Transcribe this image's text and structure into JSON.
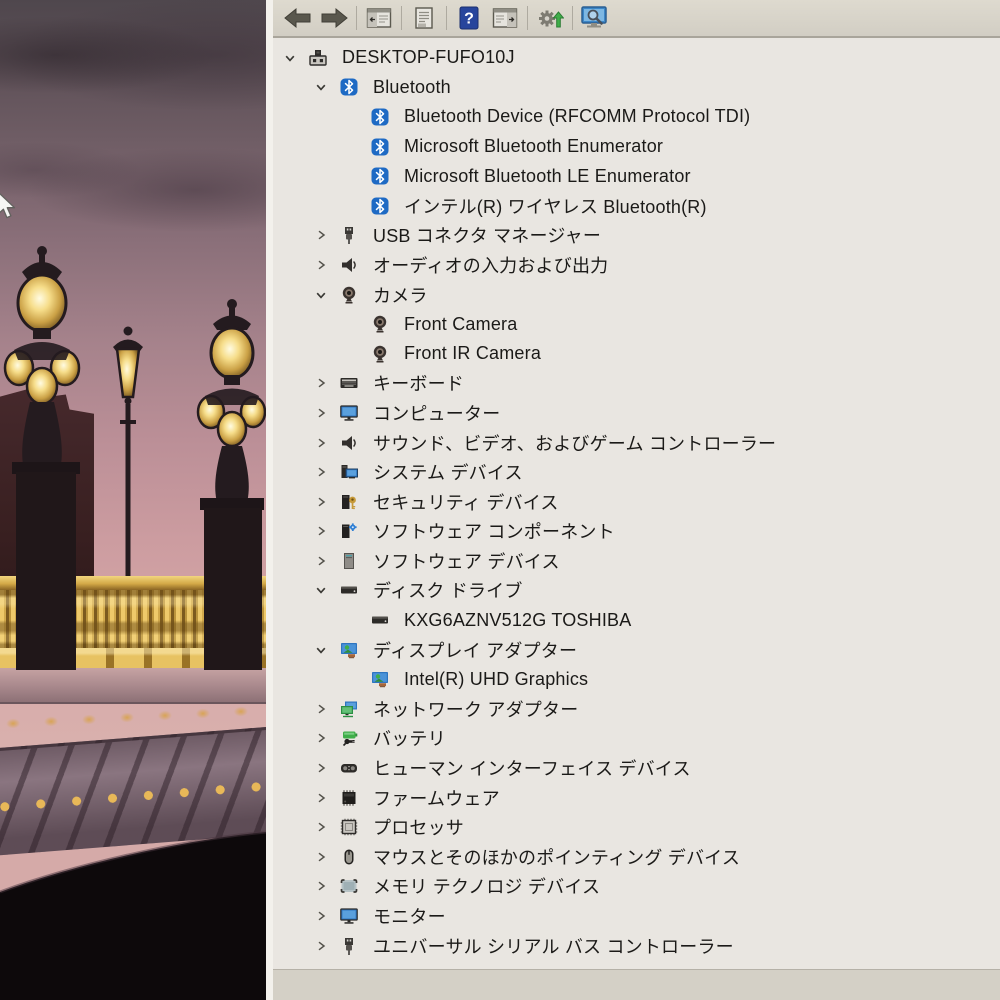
{
  "desktop": {
    "wallpaper_theme": "paris-bridge-lamps-at-dusk",
    "colors": {
      "sky_pink": "#cc9ca0",
      "gold_railing": "#d2aa4d",
      "arch_shadow": "#0d090b",
      "bluetooth_blue": "#1e6ac4",
      "window_bg": "#e9e6e1",
      "toolbar_bg": "#d6d2c8"
    }
  },
  "toolbar": {
    "button_groups": [
      [
        {
          "name": "back-button",
          "icon": "back-icon"
        },
        {
          "name": "forward-button",
          "icon": "forward-icon"
        }
      ],
      [
        {
          "name": "show-console-tree-button",
          "icon": "console-tree-icon"
        }
      ],
      [
        {
          "name": "properties-button",
          "icon": "properties-icon"
        }
      ],
      [
        {
          "name": "help-button",
          "icon": "help-icon"
        },
        {
          "name": "action-pane-button",
          "icon": "action-pane-icon"
        }
      ],
      [
        {
          "name": "update-driver-button",
          "icon": "update-driver-icon"
        }
      ],
      [
        {
          "name": "scan-hardware-changes-button",
          "icon": "scan-hardware-icon"
        }
      ]
    ]
  },
  "tree": {
    "rows": [
      {
        "label": "DESKTOP-FUFO10J",
        "level": 0,
        "expander": "expanded",
        "icon": "computer-icon"
      },
      {
        "label": "Bluetooth",
        "level": 1,
        "expander": "expanded",
        "icon": "bluetooth-icon"
      },
      {
        "label": "Bluetooth Device (RFCOMM Protocol TDI)",
        "level": 2,
        "expander": "none",
        "icon": "bluetooth-icon"
      },
      {
        "label": "Microsoft Bluetooth Enumerator",
        "level": 2,
        "expander": "none",
        "icon": "bluetooth-icon"
      },
      {
        "label": "Microsoft Bluetooth LE Enumerator",
        "level": 2,
        "expander": "none",
        "icon": "bluetooth-icon"
      },
      {
        "label": "インテル(R) ワイヤレス Bluetooth(R)",
        "level": 2,
        "expander": "none",
        "icon": "bluetooth-icon"
      },
      {
        "label": "USB コネクタ マネージャー",
        "level": 1,
        "expander": "collapsed",
        "icon": "usb-icon"
      },
      {
        "label": "オーディオの入力および出力",
        "level": 1,
        "expander": "collapsed",
        "icon": "audio-icon"
      },
      {
        "label": "カメラ",
        "level": 1,
        "expander": "expanded",
        "icon": "camera-icon"
      },
      {
        "label": "Front Camera",
        "level": 2,
        "expander": "none",
        "icon": "camera-icon"
      },
      {
        "label": "Front IR Camera",
        "level": 2,
        "expander": "none",
        "icon": "camera-icon"
      },
      {
        "label": "キーボード",
        "level": 1,
        "expander": "collapsed",
        "icon": "keyboard-icon"
      },
      {
        "label": "コンピューター",
        "level": 1,
        "expander": "collapsed",
        "icon": "monitor-icon"
      },
      {
        "label": "サウンド、ビデオ、およびゲーム コントローラー",
        "level": 1,
        "expander": "collapsed",
        "icon": "audio-icon"
      },
      {
        "label": "システム デバイス",
        "level": 1,
        "expander": "collapsed",
        "icon": "system-devices-icon"
      },
      {
        "label": "セキュリティ デバイス",
        "level": 1,
        "expander": "collapsed",
        "icon": "security-icon"
      },
      {
        "label": "ソフトウェア コンポーネント",
        "level": 1,
        "expander": "collapsed",
        "icon": "software-component-icon"
      },
      {
        "label": "ソフトウェア デバイス",
        "level": 1,
        "expander": "collapsed",
        "icon": "software-device-icon"
      },
      {
        "label": "ディスク ドライブ",
        "level": 1,
        "expander": "expanded",
        "icon": "disk-icon"
      },
      {
        "label": "KXG6AZNV512G TOSHIBA",
        "level": 2,
        "expander": "none",
        "icon": "disk-icon"
      },
      {
        "label": "ディスプレイ アダプター",
        "level": 1,
        "expander": "expanded",
        "icon": "display-adapter-icon"
      },
      {
        "label": "Intel(R) UHD Graphics",
        "level": 2,
        "expander": "none",
        "icon": "display-adapter-icon"
      },
      {
        "label": "ネットワーク アダプター",
        "level": 1,
        "expander": "collapsed",
        "icon": "network-icon"
      },
      {
        "label": "バッテリ",
        "level": 1,
        "expander": "collapsed",
        "icon": "battery-icon"
      },
      {
        "label": "ヒューマン インターフェイス デバイス",
        "level": 1,
        "expander": "collapsed",
        "icon": "hid-icon"
      },
      {
        "label": "ファームウェア",
        "level": 1,
        "expander": "collapsed",
        "icon": "firmware-icon"
      },
      {
        "label": "プロセッサ",
        "level": 1,
        "expander": "collapsed",
        "icon": "processor-icon"
      },
      {
        "label": "マウスとそのほかのポインティング デバイス",
        "level": 1,
        "expander": "collapsed",
        "icon": "mouse-icon"
      },
      {
        "label": "メモリ テクノロジ デバイス",
        "level": 1,
        "expander": "collapsed",
        "icon": "memory-icon"
      },
      {
        "label": "モニター",
        "level": 1,
        "expander": "collapsed",
        "icon": "monitor-icon"
      },
      {
        "label": "ユニバーサル シリアル バス コントローラー",
        "level": 1,
        "expander": "collapsed",
        "icon": "usb-icon"
      }
    ]
  }
}
